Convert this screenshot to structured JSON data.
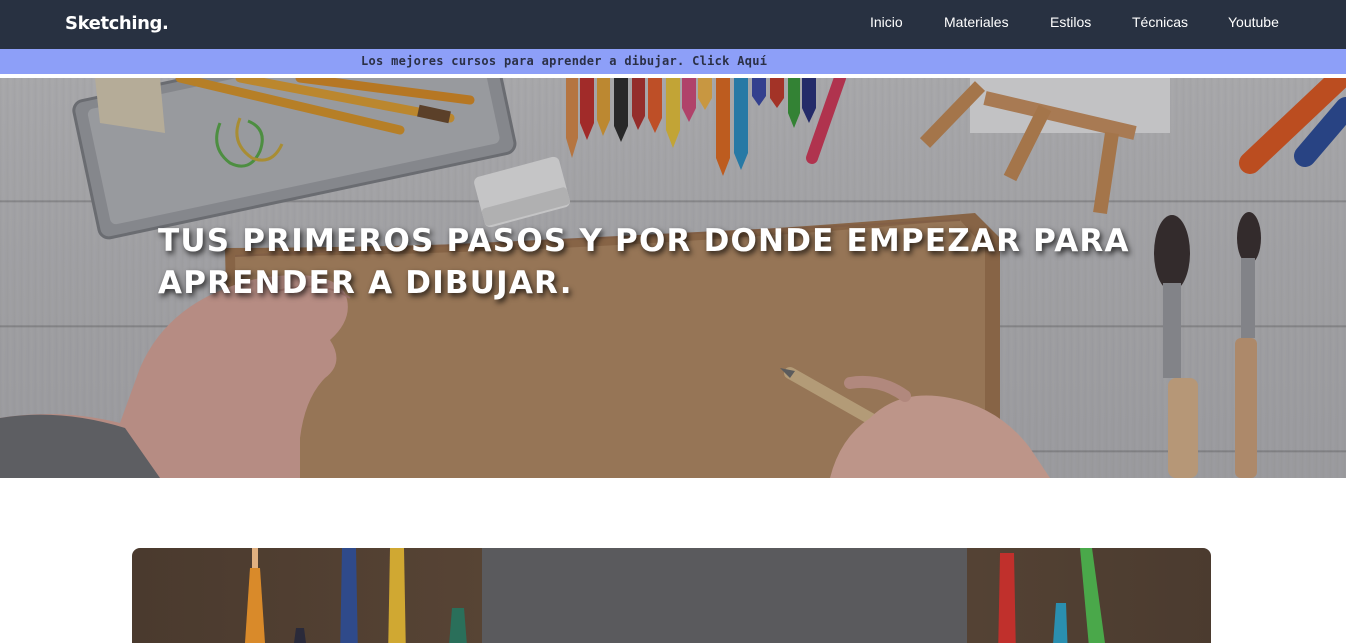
{
  "brand": "Sketching.",
  "nav": {
    "items": [
      {
        "label": "Inicio"
      },
      {
        "label": "Materiales"
      },
      {
        "label": "Estilos"
      },
      {
        "label": "Técnicas"
      },
      {
        "label": "Youtube"
      }
    ]
  },
  "promo": {
    "text": "Los mejores cursos para aprender a dibujar. Click Aquí"
  },
  "hero": {
    "title": "TUS PRIMEROS PASOS Y POR DONDE EMPEZAR PARA APRENDER A DIBUJAR."
  },
  "colors": {
    "navbar_bg": "#283141",
    "promo_bg": "#8d9ff8",
    "promo_text": "#2b3046",
    "hero_text": "#ffffff"
  }
}
